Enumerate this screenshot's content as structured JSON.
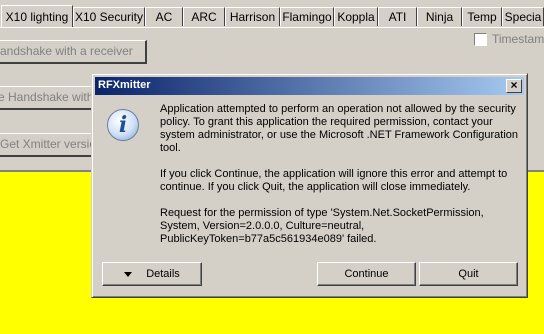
{
  "tabs": [
    "X10 lighting",
    "X10 Security",
    "AC",
    "ARC",
    "Harrison",
    "Flamingo",
    "Koppla",
    "ATI",
    "Ninja",
    "Temp",
    "Specia"
  ],
  "background": {
    "handshake_button": "andshake with a receiver",
    "handshake2_button": "e Handshake with a",
    "get_version_button": "Get Xmitter version",
    "timestamp_label": "Timestamp",
    "timestamp_checked": false,
    "panel_color": "#ffff00"
  },
  "dialog": {
    "title": "RFXmitter",
    "close_glyph": "×",
    "icon": "information-icon",
    "message1": "Application attempted to perform an operation not allowed by the security policy. To grant this application the required permission, contact your system administrator, or use the Microsoft .NET Framework Configuration tool.",
    "message2": "If you click Continue, the application will ignore this error and attempt to continue. If you click Quit, the application will close immediately.",
    "message3": "Request for the permission of type 'System.Net.SocketPermission, System, Version=2.0.0.0, Culture=neutral, PublicKeyToken=b77a5c561934e089' failed.",
    "details_button": "Details",
    "continue_button": "Continue",
    "quit_button": "Quit"
  }
}
